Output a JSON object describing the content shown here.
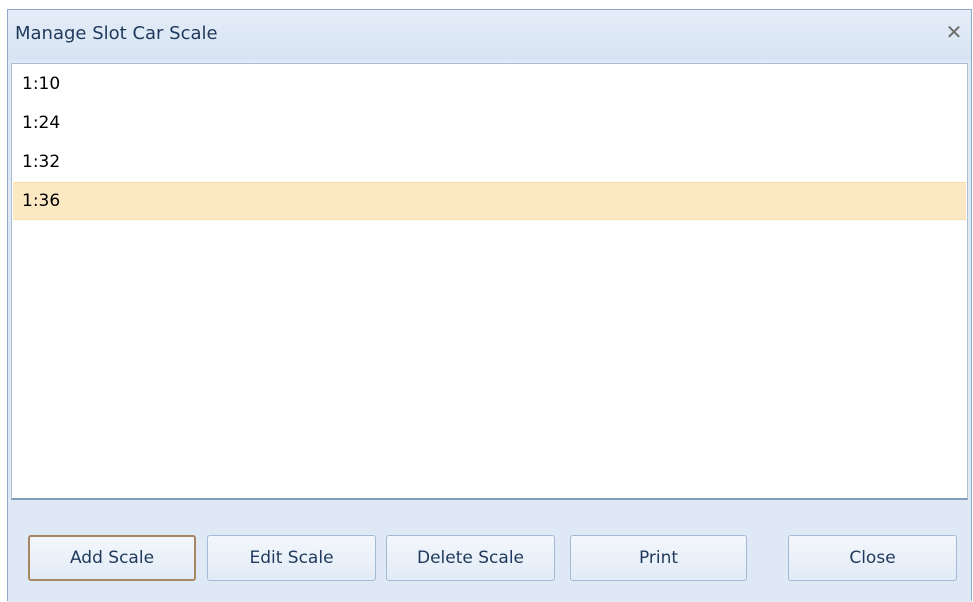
{
  "window": {
    "title": "Manage Slot Car Scale",
    "close_glyph": "✕"
  },
  "list": {
    "items": [
      {
        "label": "1:10",
        "selected": false
      },
      {
        "label": "1:24",
        "selected": false
      },
      {
        "label": "1:32",
        "selected": false
      },
      {
        "label": "1:36",
        "selected": true
      }
    ]
  },
  "buttons": {
    "add": "Add Scale",
    "edit": "Edit Scale",
    "delete": "Delete Scale",
    "print": "Print",
    "close": "Close"
  },
  "colors": {
    "selection": "#fde8c4",
    "dialog_background": "#dfe9f5",
    "title_text": "#1e395b"
  }
}
